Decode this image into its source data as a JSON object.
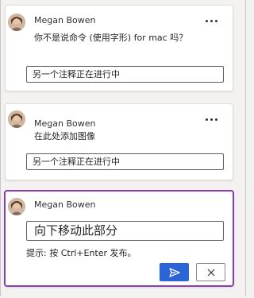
{
  "comments": [
    {
      "author": "Megan Bowen",
      "text": "你不是说命令 (使用字形) for mac 吗？",
      "reply_field": "另一个注释正在进行中",
      "more_icon": "ellipsis-icon"
    },
    {
      "author": "Megan Bowen",
      "text": "在此处添加图像",
      "reply_field": "另一个注释正在进行中",
      "more_icon": "ellipsis-icon"
    }
  ],
  "composer": {
    "author": "Megan Bowen",
    "editor_value": "向下移动此部分",
    "hint": "提示: 按 Ctrl+Enter 发布。",
    "send_icon": "send-icon",
    "cancel_icon": "close-icon",
    "accent_color": "#8a3fb0",
    "send_color": "#2b64d6"
  }
}
